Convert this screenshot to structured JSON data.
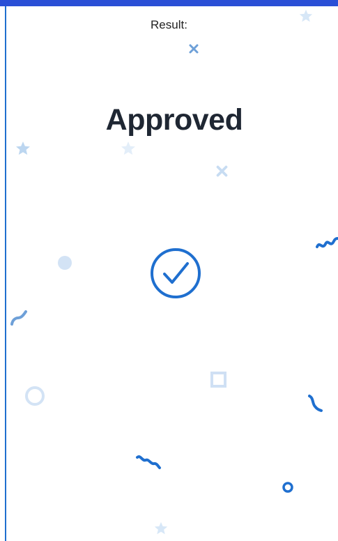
{
  "result": {
    "label": "Result:",
    "status": "Approved"
  },
  "icons": {
    "status": "check-circle-icon"
  },
  "colors": {
    "top_bar": "#2a4fd6",
    "accent": "#1f6fcf",
    "light_accent": "#cfe0f4",
    "title": "#1f2733"
  }
}
